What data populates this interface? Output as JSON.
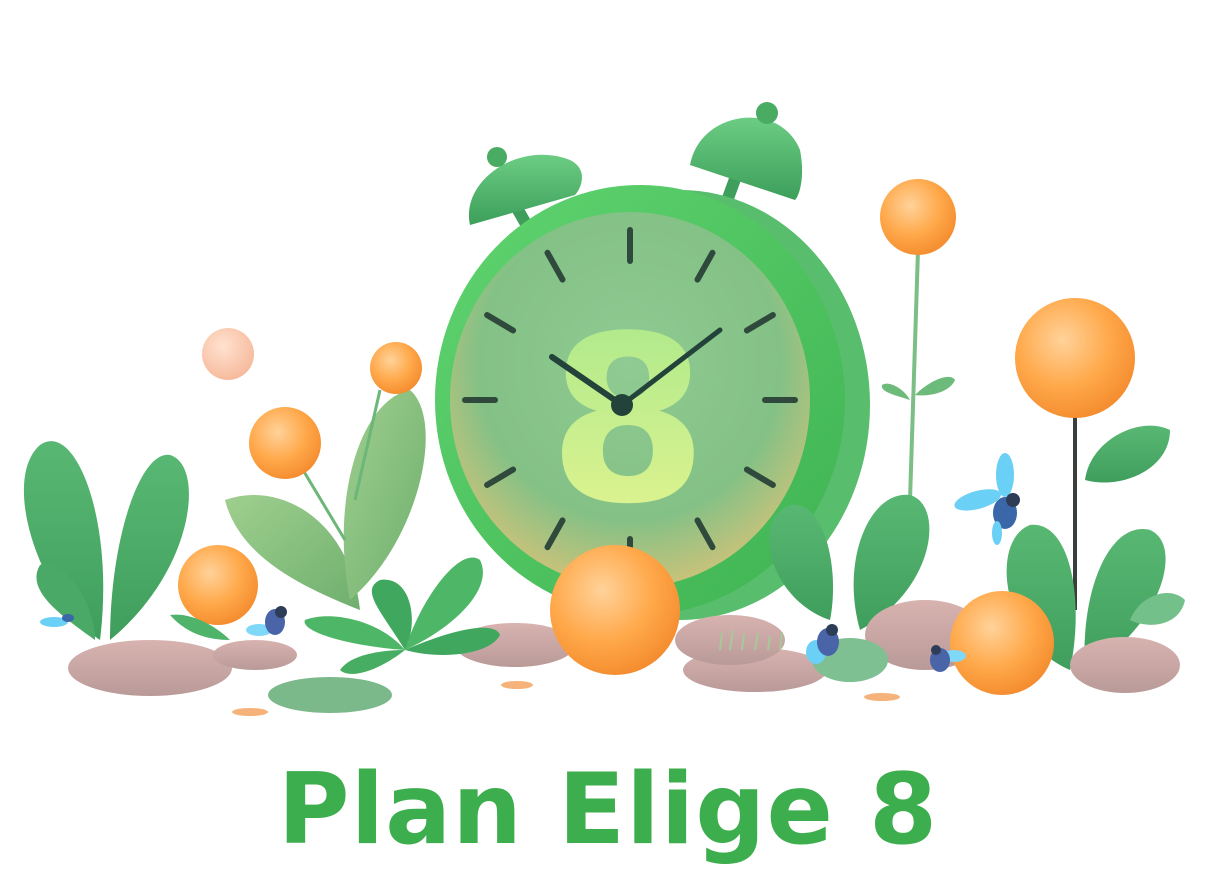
{
  "title": "Plan Elige 8",
  "clock_numeral": "8",
  "colors": {
    "brand_green": "#3dae4e",
    "clock_rim": "#4cc85e",
    "clock_face": "#86c489",
    "numeral": "#d9f287",
    "fruit_orange": "#ffa544",
    "leaf_green": "#4fae67",
    "stone_mauve": "#cfa6a4",
    "bug_blue": "#4aa8f0"
  },
  "icons": [
    "alarm-clock-icon",
    "bug-icon",
    "orange-fruit-icon",
    "leaf-icon"
  ]
}
